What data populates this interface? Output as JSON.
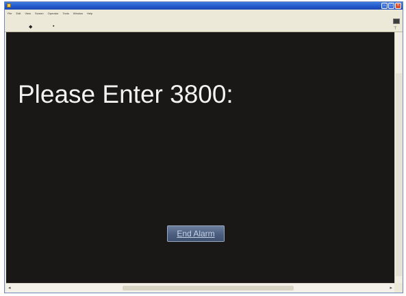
{
  "window": {
    "title": "",
    "controls": [
      "minimize-icon",
      "maximize-icon",
      "close-icon"
    ]
  },
  "menu": {
    "items": [
      "File",
      "Edit",
      "View",
      "Screen",
      "Operator",
      "Tools",
      "Window",
      "Help"
    ]
  },
  "main": {
    "prompt": "Please Enter 3800:",
    "end_alarm_button": "End Alarm"
  },
  "colors": {
    "canvas_background": "#1a1817",
    "prompt_text": "#f2f2f2",
    "button_fill": "#4a5e80",
    "titlebar": "#2256c9"
  }
}
